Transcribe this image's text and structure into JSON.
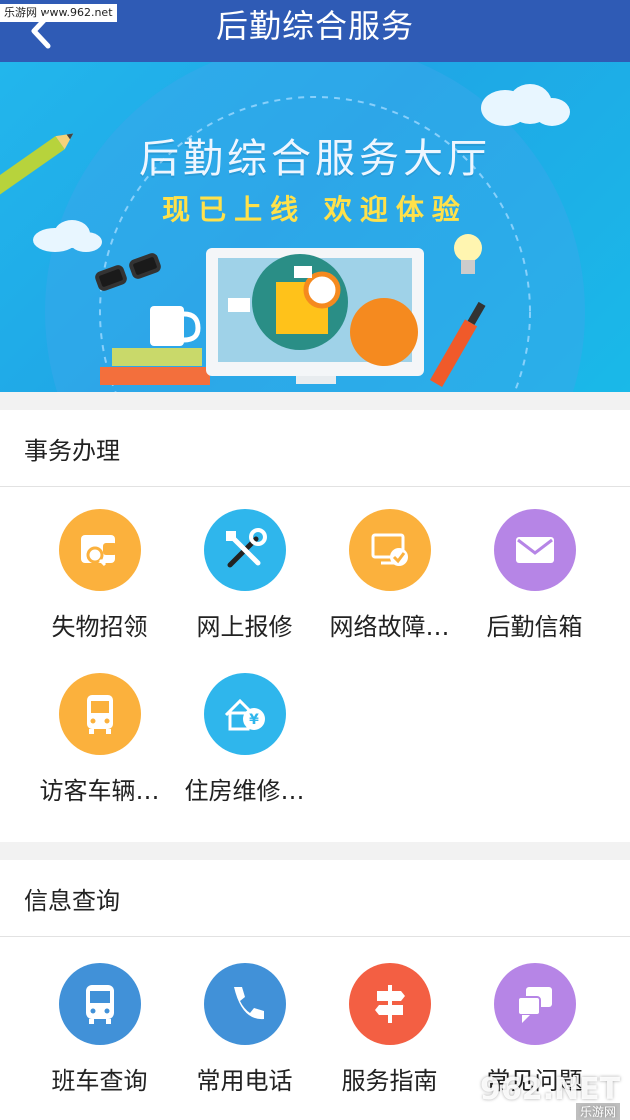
{
  "header": {
    "title": "后勤综合服务",
    "watermark": "乐游网 www.962.net"
  },
  "banner": {
    "title": "后勤综合服务大厅",
    "subtitle": "现已上线 欢迎体验"
  },
  "sections": [
    {
      "title": "事务办理",
      "items": [
        {
          "label": "失物招领",
          "icon": "wallet-search-icon",
          "color": "#fbb13d"
        },
        {
          "label": "网上报修",
          "icon": "tools-icon",
          "color": "#2fb6ec"
        },
        {
          "label": "网络故障…",
          "icon": "monitor-check-icon",
          "color": "#fbb13d"
        },
        {
          "label": "后勤信箱",
          "icon": "mail-icon",
          "color": "#b685e6"
        },
        {
          "label": "访客车辆…",
          "icon": "bus-icon",
          "color": "#fbb13d"
        },
        {
          "label": "住房维修…",
          "icon": "house-yen-icon",
          "color": "#2fb6ec"
        }
      ]
    },
    {
      "title": "信息查询",
      "items": [
        {
          "label": "班车查询",
          "icon": "bus-icon",
          "color": "#4191d8"
        },
        {
          "label": "常用电话",
          "icon": "phone-icon",
          "color": "#4191d8"
        },
        {
          "label": "服务指南",
          "icon": "signpost-icon",
          "color": "#f35f43"
        },
        {
          "label": "常见问题",
          "icon": "chat-icon",
          "color": "#b685e6"
        }
      ]
    }
  ],
  "footer_watermark": {
    "logo": "962.NET",
    "text": "乐游网"
  }
}
